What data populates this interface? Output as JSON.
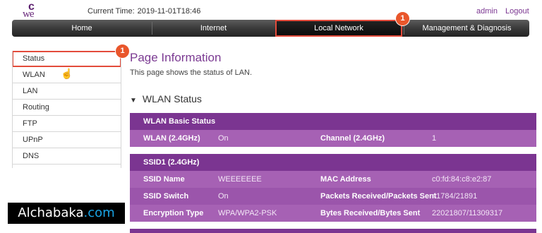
{
  "header": {
    "logo_text": "we",
    "current_time_label": "Current Time:",
    "current_time_value": "2019-11-01T18:46",
    "user": "admin",
    "logout": "Logout"
  },
  "nav": {
    "tabs": [
      {
        "label": "Home"
      },
      {
        "label": "Internet"
      },
      {
        "label": "Local Network"
      },
      {
        "label": "Management & Diagnosis"
      }
    ],
    "active_index": 2,
    "badge": "1"
  },
  "sidebar": {
    "items": [
      {
        "label": "Status"
      },
      {
        "label": "WLAN"
      },
      {
        "label": "LAN"
      },
      {
        "label": "Routing"
      },
      {
        "label": "FTP"
      },
      {
        "label": "UPnP"
      },
      {
        "label": "DNS"
      }
    ],
    "active_index": 0,
    "badge": "1"
  },
  "main": {
    "title": "Page Information",
    "description": "This page shows the status of LAN.",
    "section_title": "WLAN Status",
    "basic": {
      "header": "WLAN Basic Status",
      "rows": [
        {
          "k1": "WLAN (2.4GHz)",
          "v1": "On",
          "k2": "Channel (2.4GHz)",
          "v2": "1"
        }
      ]
    },
    "ssid": {
      "header": "SSID1 (2.4GHz)",
      "rows": [
        {
          "k1": "SSID Name",
          "v1": "WEEEEEEE",
          "k2": "MAC Address",
          "v2": "c0:fd:84:c8:e2:87"
        },
        {
          "k1": "SSID Switch",
          "v1": "On",
          "k2": "Packets Received/Packets Sent",
          "v2": "41784/21891"
        },
        {
          "k1": "Encryption Type",
          "v1": "WPA/WPA2-PSK",
          "k2": "Bytes Received/Bytes Sent",
          "v2": "22021807/11309317"
        }
      ]
    }
  },
  "watermark": {
    "main": "Alchabaka",
    "dot": ".",
    "tld": "com"
  },
  "colors": {
    "accent": "#7b3591",
    "highlight": "#e34b3b",
    "badge": "#e9562b"
  }
}
